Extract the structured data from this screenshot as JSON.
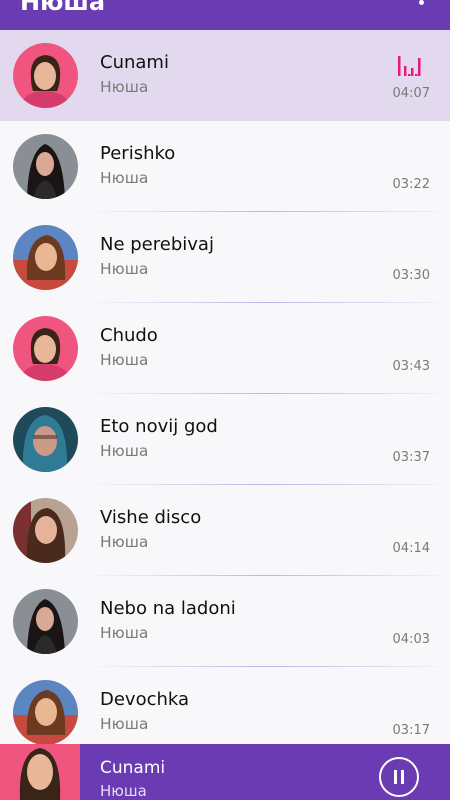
{
  "appbar": {
    "title": "Нюша",
    "menu_icon": "overflow-menu-icon"
  },
  "colors": {
    "primary": "#6a3bb3",
    "active_row": "#e3d9ef",
    "equalizer": "#e6197e"
  },
  "playing_icon": "equalizer-icon",
  "songs": [
    {
      "title": "Cunami",
      "artist": "Нюша",
      "duration": "04:07",
      "playing": true
    },
    {
      "title": "Perishko",
      "artist": "Нюша",
      "duration": "03:22"
    },
    {
      "title": "Ne perebivaj",
      "artist": "Нюша",
      "duration": "03:30"
    },
    {
      "title": "Chudo",
      "artist": "Нюша",
      "duration": "03:43"
    },
    {
      "title": "Eto novij god",
      "artist": "Нюша",
      "duration": "03:37"
    },
    {
      "title": "Vishe disco",
      "artist": "Нюша",
      "duration": "04:14"
    },
    {
      "title": "Nebo na ladoni",
      "artist": "Нюша",
      "duration": "04:03"
    },
    {
      "title": "Devochka",
      "artist": "Нюша",
      "duration": "03:17"
    }
  ],
  "player": {
    "title": "Cunami",
    "artist": "Нюша",
    "control_icon": "pause-icon"
  }
}
